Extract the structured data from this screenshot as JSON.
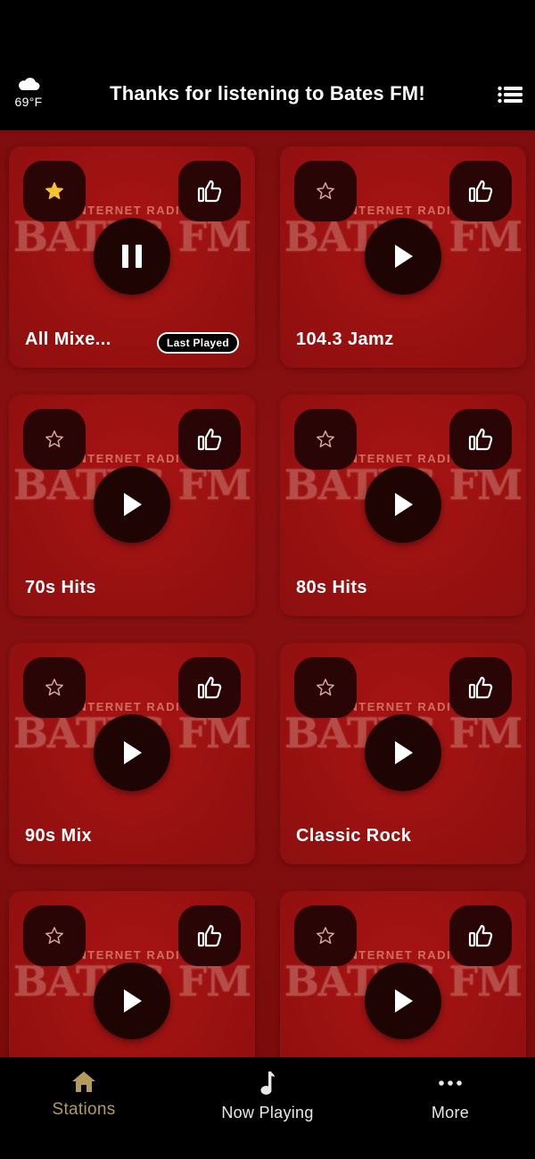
{
  "header": {
    "weather_icon": "cloud-icon",
    "temperature": "69°F",
    "title": "Thanks for listening to Bates FM!",
    "menu_icon": "list-menu-icon"
  },
  "logo": {
    "sub": "INTERNET RADIO",
    "main": "BATES FM"
  },
  "colors": {
    "accent_gold": "#b59a5c",
    "star_gold": "#f4c531",
    "card_red": "#a01212"
  },
  "stations": [
    {
      "name": "All Mixe...",
      "favorite": true,
      "playing": true,
      "badge": "Last Played"
    },
    {
      "name": "104.3 Jamz",
      "favorite": false,
      "playing": false,
      "badge": ""
    },
    {
      "name": "70s Hits",
      "favorite": false,
      "playing": false,
      "badge": ""
    },
    {
      "name": "80s Hits",
      "favorite": false,
      "playing": false,
      "badge": ""
    },
    {
      "name": "90s Mix",
      "favorite": false,
      "playing": false,
      "badge": ""
    },
    {
      "name": "Classic Rock",
      "favorite": false,
      "playing": false,
      "badge": ""
    },
    {
      "name": "",
      "favorite": false,
      "playing": false,
      "badge": ""
    },
    {
      "name": "",
      "favorite": false,
      "playing": false,
      "badge": ""
    }
  ],
  "tabs": [
    {
      "label": "Stations",
      "icon": "home-icon",
      "active": true
    },
    {
      "label": "Now Playing",
      "icon": "music-note-icon",
      "active": false
    },
    {
      "label": "More",
      "icon": "more-dots-icon",
      "active": false
    }
  ]
}
